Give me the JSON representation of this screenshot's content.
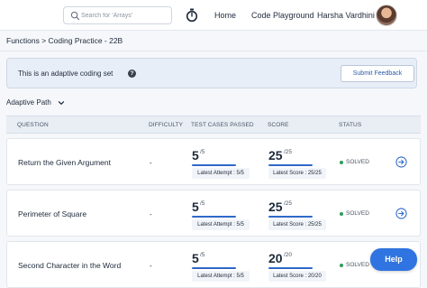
{
  "header": {
    "search_placeholder": "Search for 'Arrays'",
    "nav_home": "Home",
    "nav_code_playground": "Code Playground",
    "user_name": "Harsha Vardhini"
  },
  "breadcrumb": "Functions > Coding Practice - 22B",
  "banner": {
    "text": "This is an adaptive coding set",
    "info_icon": "?",
    "feedback_label": "Submit Feedback"
  },
  "path_select": {
    "label": "Adaptive Path"
  },
  "table": {
    "columns": {
      "question": "QUESTION",
      "difficulty": "DIFFICULTY",
      "test_cases": "TEST CASES PASSED",
      "score": "SCORE",
      "status": "STATUS"
    },
    "rows": [
      {
        "title": "Return the Given Argument",
        "difficulty": "-",
        "tests_passed": "5",
        "tests_total": "/5",
        "tests_fraction": 1.0,
        "latest_attempt": "Latest Attempt : 5/5",
        "score": "25",
        "score_total": "/25",
        "score_fraction": 1.0,
        "latest_score": "Latest Score : 25/25",
        "status": "SOLVED"
      },
      {
        "title": "Perimeter of Square",
        "difficulty": "-",
        "tests_passed": "5",
        "tests_total": "/5",
        "tests_fraction": 1.0,
        "latest_attempt": "Latest Attempt : 5/5",
        "score": "25",
        "score_total": "/25",
        "score_fraction": 1.0,
        "latest_score": "Latest Score : 25/25",
        "status": "SOLVED"
      },
      {
        "title": "Second Character in the Word",
        "difficulty": "-",
        "tests_passed": "5",
        "tests_total": "/5",
        "tests_fraction": 1.0,
        "latest_attempt": "Latest Attempt : 5/5",
        "score": "20",
        "score_total": "/20",
        "score_fraction": 1.0,
        "latest_score": "Latest Score : 20/20",
        "status": "SOLVED"
      }
    ]
  },
  "help_label": "Help",
  "colors": {
    "accent": "#2f69c9",
    "help_button": "#2f74e0",
    "solved": "#2e9d5a",
    "banner_bg": "#e8eef7"
  },
  "icons": {
    "search": "search-icon",
    "timer": "stopwatch-icon",
    "info": "info-icon",
    "chevron": "chevron-down-icon",
    "row_action": "arrow-right-circle-icon"
  }
}
